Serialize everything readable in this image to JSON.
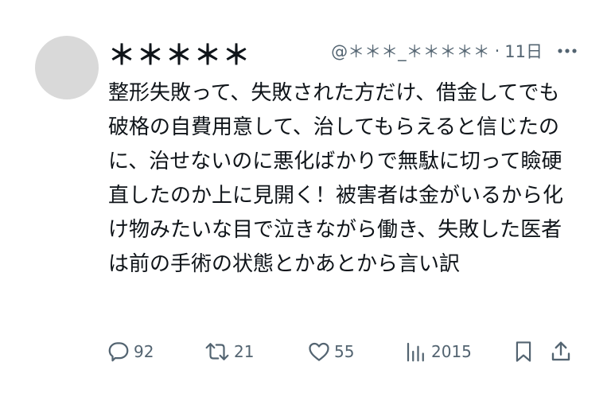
{
  "post": {
    "display_name": "＊＊＊＊＊",
    "handle": "@＊＊＊_＊＊＊＊＊",
    "separator": "·",
    "time": "11日",
    "text": "整形失敗って、失敗された方だけ、借金してでも破格の自費用意して、治してもらえると信じたのに、治せないのに悪化ばかりで無駄に切って瞼硬直したのか上に見開く！被害者は金がいるから化け物みたいな目で泣きながら働き、失敗した医者は前の手術の状態とかあとから言い訳"
  },
  "actions": {
    "replies": "92",
    "reposts": "21",
    "likes": "55",
    "views": "2015"
  },
  "icons": {
    "more": "more-horizontal-icon",
    "reply": "reply-bubble-icon",
    "repost": "repost-icon",
    "like": "heart-icon",
    "views": "views-bar-chart-icon",
    "bookmark": "bookmark-icon",
    "share": "share-icon"
  },
  "colors": {
    "text": "#0f1419",
    "secondary": "#536471",
    "avatar": "#d9d9d9"
  }
}
